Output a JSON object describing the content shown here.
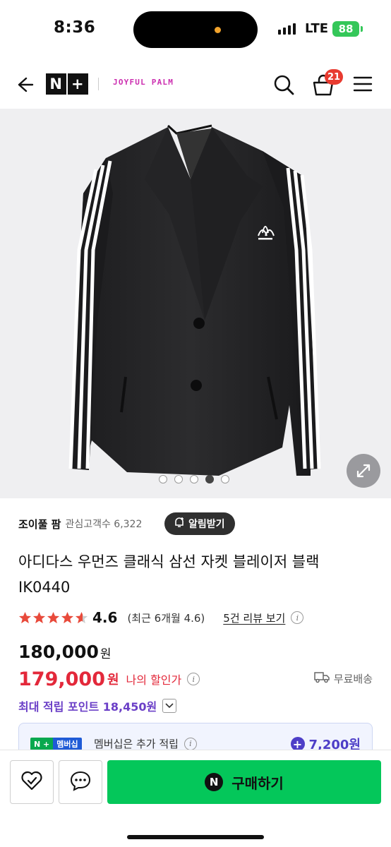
{
  "status_bar": {
    "time": "8:36",
    "network": "LTE",
    "battery": "88"
  },
  "header": {
    "logo_text": "N+",
    "brand_text": "JOYFUL PALM",
    "cart_count": "21",
    "icons": [
      "back-arrow-icon",
      "search-icon",
      "cart-icon",
      "hamburger-menu-icon"
    ]
  },
  "gallery": {
    "image_count": 5,
    "active_index": 3,
    "expand_icon": "expand-icon"
  },
  "store": {
    "name": "조이풀 팜",
    "favorites_label": "관심고객수 6,322",
    "alarm_button": "알림받기"
  },
  "product": {
    "title": "아디다스 우먼즈 클래식 삼선 자켓 블레이저 블랙 IK0440",
    "rating": "4.6",
    "rating_stars": 4.6,
    "recent_rating": "(최근 6개월 4.6)",
    "reviews_link": "5건 리뷰 보기",
    "price": "180,000",
    "price_unit": "원",
    "discount_price": "179,000",
    "discount_unit": "원",
    "discount_label": "나의 할인가",
    "shipping": "무료배송",
    "points": "최대 적립 포인트 18,450원"
  },
  "membership": {
    "badge_np": "N +",
    "badge_mb": "멤버십",
    "text": "멤버십은 추가 적립",
    "amount": "7,200원"
  },
  "bottom_bar": {
    "buy_label": "구매하기",
    "buy_logo": "N"
  },
  "colors": {
    "accent_green": "#04c75a",
    "discount_red": "#e3283a",
    "points_purple": "#6b3fc7",
    "brand_pink": "#cc2fb0"
  }
}
